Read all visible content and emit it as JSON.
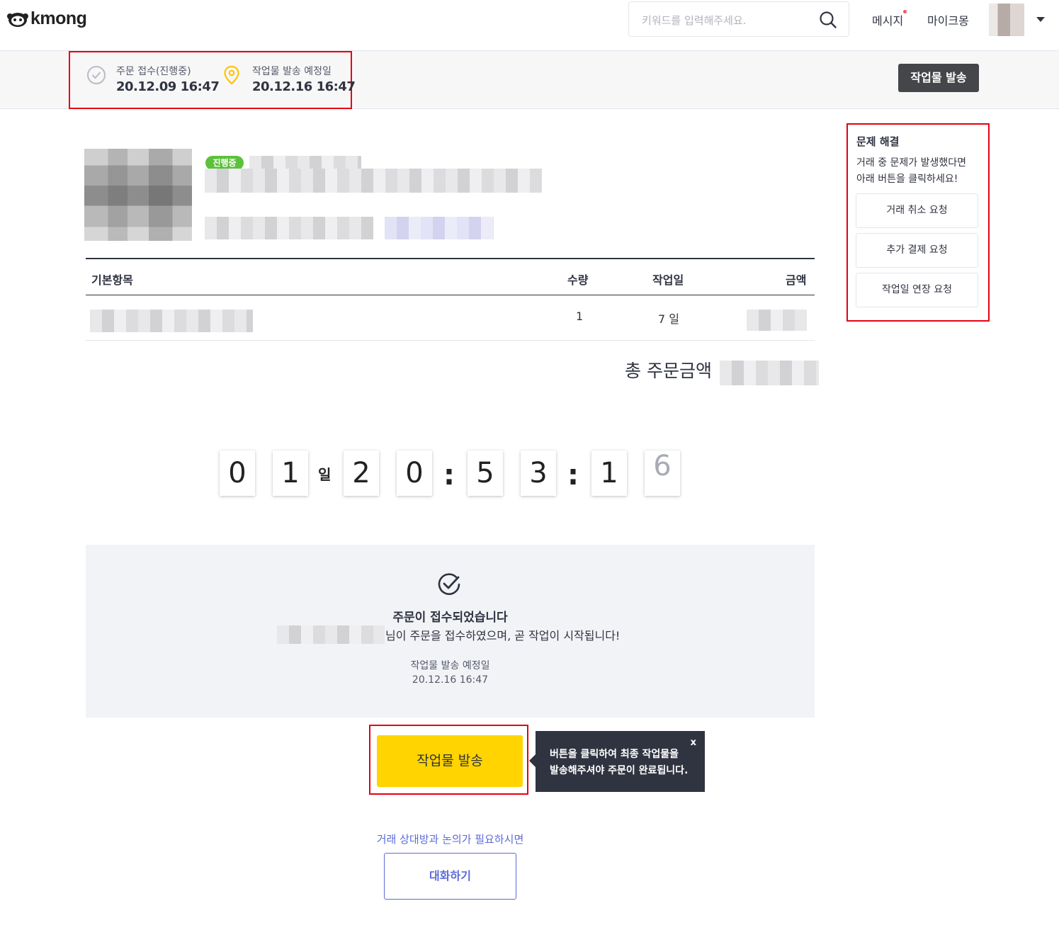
{
  "header": {
    "brand": "kmong",
    "search_placeholder": "키워드를 입력해주세요.",
    "nav_message": "메시지",
    "nav_mykmong": "마이크몽",
    "icons": [
      "search-icon",
      "chevron-down-icon",
      "logo-icon"
    ]
  },
  "status": {
    "order_received_label": "주문 접수(진행중)",
    "order_received_date": "20.12.09 16:47",
    "delivery_due_label": "작업물 발송 예정일",
    "delivery_due_date": "20.12.16 16:47",
    "deliver_button": "작업물 발송"
  },
  "product": {
    "status_badge": "진행중"
  },
  "table": {
    "headers": {
      "item": "기본항목",
      "qty": "수량",
      "days": "작업일",
      "price": "금액"
    },
    "rows": [
      {
        "qty": "1",
        "days": "7 일"
      }
    ],
    "total_label": "총 주문금액"
  },
  "countdown": {
    "digits": [
      "0",
      "1",
      "2",
      "0",
      "5",
      "3",
      "1",
      "6"
    ],
    "day_unit": "일",
    "separator": ":"
  },
  "panel": {
    "title": "주문이 접수되었습니다",
    "description": "님이 주문을 접수하였으며, 곧 작업이 시작됩니다!",
    "due_label": "작업물 발송 예정일",
    "due_date": "20.12.16 16:47"
  },
  "cta": {
    "deliver_button": "작업물 발송",
    "tooltip_line1": "버튼을 클릭하여 최종 작업물을",
    "tooltip_line2": "발송해주셔야 주문이 완료됩니다.",
    "tooltip_close": "x"
  },
  "chat": {
    "hint": "거래 상대방과 논의가 필요하시면",
    "button": "대화하기"
  },
  "sidebar": {
    "title": "문제 해결",
    "desc_line1": "거래 중 문제가 발생했다면",
    "desc_line2": "아래 버튼을 클릭하세요!",
    "buttons": [
      "거래 취소 요청",
      "추가 결제 요청",
      "작업일 연장 요청"
    ]
  },
  "colors": {
    "accent_yellow": "#ffd400",
    "badge_green": "#5cc13b",
    "link_blue": "#5c6bd8",
    "highlight_red": "#e60012",
    "dark": "#303441"
  }
}
